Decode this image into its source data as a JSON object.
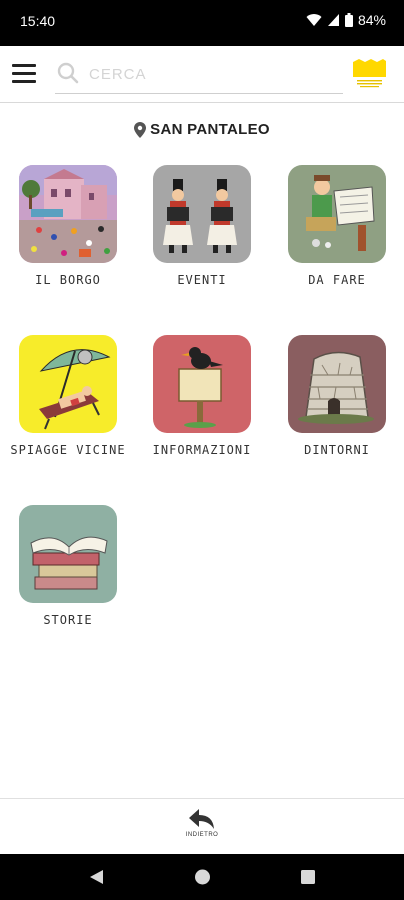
{
  "status_bar": {
    "time": "15:40",
    "battery": "84%"
  },
  "header": {
    "search_placeholder": "CERCA"
  },
  "location": {
    "label": "SAN PANTALEO"
  },
  "tiles": [
    {
      "label": "IL BORGO"
    },
    {
      "label": "EVENTI"
    },
    {
      "label": "DA FARE"
    },
    {
      "label": "SPIAGGE VICINE"
    },
    {
      "label": "INFORMAZIONI"
    },
    {
      "label": "DINTORNI"
    },
    {
      "label": "STORIE"
    }
  ],
  "footer": {
    "back_label": "INDIETRO"
  },
  "colors": {
    "tile_borgo": "#c9a0c8",
    "tile_eventi": "#a6a6a6",
    "tile_dafare": "#8fa083",
    "tile_spiagge": "#f7ec2a",
    "tile_info": "#cf6468",
    "tile_dintorni": "#8a5e60",
    "tile_storie": "#8fb0a3",
    "logo_yellow": "#ffd800"
  }
}
